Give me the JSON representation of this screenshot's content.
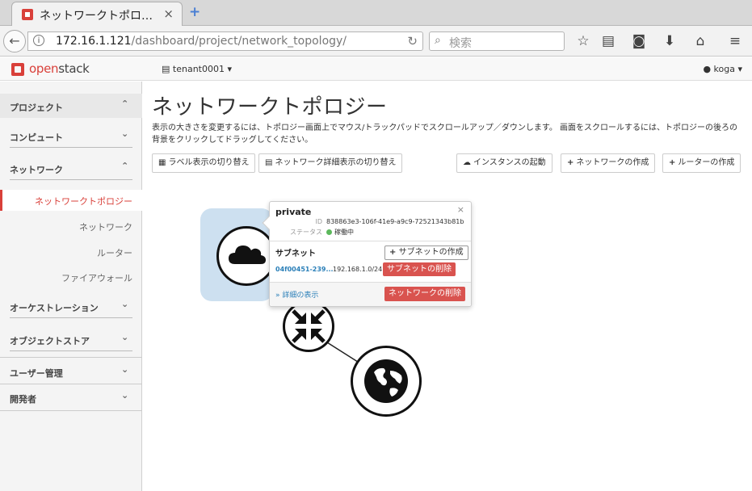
{
  "browser": {
    "tab_title": "ネットワークトポロ…",
    "tab_close": "×",
    "new_tab": "+",
    "url_host": "172.16.1.121",
    "url_path": "/dashboard/project/network_topology/",
    "search_placeholder": "検索"
  },
  "header": {
    "logo_part1": "open",
    "logo_part2": "stack",
    "project": "tenant0001 ▾",
    "user": "koga ▾"
  },
  "sidebar": {
    "project": "プロジェクト",
    "compute": "コンピュート",
    "network": "ネットワーク",
    "items": [
      "ネットワークトポロジー",
      "ネットワーク",
      "ルーター",
      "ファイアウォール"
    ],
    "orchestration": "オーケストレーション",
    "object_store": "オブジェクトストア",
    "user_mgmt": "ユーザー管理",
    "developer": "開発者"
  },
  "main": {
    "title": "ネットワークトポロジー",
    "description": "表示の大きさを変更するには、トポロジー画面上でマウス/トラックパッドでスクロールアップ／ダウンします。 画面をスクロールするには、トポロジーの後ろの背景をクリックしてドラッグしてください。",
    "btn_toggle_labels": "ラベル表示の切り替え",
    "btn_toggle_network": "ネットワーク詳細表示の切り替え",
    "btn_launch": "インスタンスの起動",
    "btn_create_network": "ネットワークの作成",
    "btn_create_router": "ルーターの作成"
  },
  "popover": {
    "name": "private",
    "close": "×",
    "id_label": "ID",
    "id_value": "838863e3-106f-41e9-a9c9-72521343b81b",
    "status_label": "ステータス",
    "status_value": "稼働中",
    "subnet_heading": "サブネット",
    "create_subnet": "サブネットの作成",
    "subnet_link": "04f00451-239...",
    "subnet_cidr": "192.168.1.0/24",
    "delete_subnet": "サブネットの削除",
    "details": "» 詳細の表示",
    "delete_network": "ネットワークの削除"
  },
  "colors": {
    "accent": "#d9403a",
    "danger": "#d9534f",
    "status_active": "#5cb85c",
    "network_bar": "#cde0f0"
  }
}
